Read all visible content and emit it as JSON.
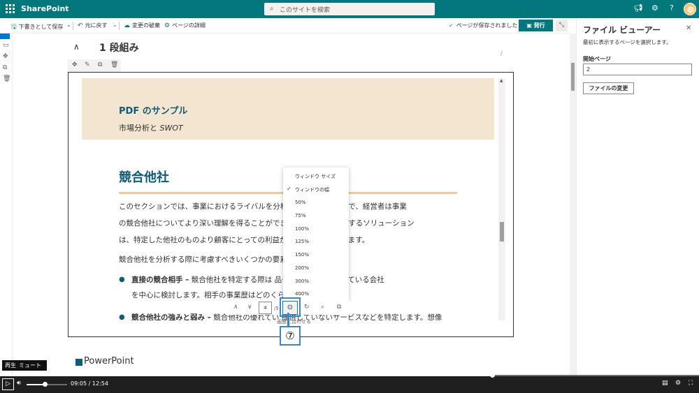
{
  "app": {
    "brand": "SharePoint"
  },
  "search": {
    "placeholder": "このサイトを検索"
  },
  "toolbar": {
    "save_draft": "下書きとして保存",
    "undo": "元に戻す",
    "discard": "変更の破棄",
    "page_details": "ページの詳細",
    "saved_status": "ページが保存されました",
    "publish": "発行"
  },
  "section": {
    "title": "1 段組み"
  },
  "pdf": {
    "header_title": "PDF のサンプル",
    "header_subtitle_prefix": "市場分析と ",
    "header_subtitle_italic": "SWOT",
    "heading": "競合他社",
    "p1_line1": "このセクションでは、事業におけるライバルを分析し、          析を行うことで、経営者は事業",
    "p1_line2": "の競合他社についてより深い理解を得ることができま            は、自社が提供するソリューション",
    "p1_line3": "は、特定した他社のものより顧客にとっての利益が大             明するようにします。",
    "p2": "競合他社を分析する際に考慮すべきいくつかの要素",
    "b1_bold": "直接の競合相手 –",
    "b1_rest": " 競合他社を特定する際は             品やサービスを提供している会社",
    "b1_line2": "を中心に検討します。相手の事業歴はどのくらい",
    "b2_bold": "競合他社の強みと弱み –",
    "b2_rest": " 競合他社の優れてい        提供していないサービスなどを特定します。想像"
  },
  "viewer": {
    "page_number": "4",
    "page_total": "/5",
    "zoom_tooltip": "画面に合わせる"
  },
  "zoom_menu": {
    "items": [
      "ウィンドウ サイズ",
      "ウィンドウの幅",
      "50%",
      "75%",
      "100%",
      "125%",
      "150%",
      "200%",
      "300%",
      "400%"
    ],
    "selected": "ウィンドウの幅"
  },
  "callout": {
    "step": "⑦"
  },
  "next_section": {
    "label": "PowerPoint"
  },
  "pane": {
    "title": "ファイル ビューアー",
    "description": "最初に表示するページを選択します。",
    "start_page_label": "開始ページ",
    "start_page_value": "2",
    "change_file": "ファイルの変更"
  },
  "video": {
    "tooltip_play": "再生",
    "tooltip_mute": "ミュート",
    "current_time": "09:05",
    "separator": "/",
    "duration": "12:54",
    "progress_fraction": 0.704,
    "volume_fraction": 0.45
  },
  "colors": {
    "suite_bar": "#03787c",
    "accent": "#0f5b78",
    "highlight": "#3b87c6"
  }
}
